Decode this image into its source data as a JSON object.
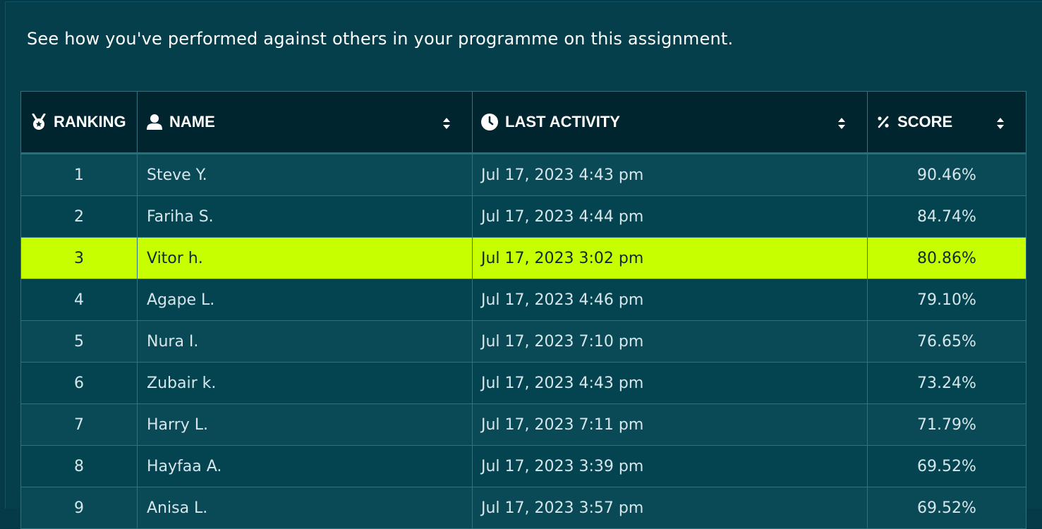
{
  "intro_text": "See how you've performed against others in your programme on this assignment.",
  "columns": {
    "ranking": "RANKING",
    "name": "NAME",
    "last_activity": "LAST ACTIVITY",
    "score": "SCORE"
  },
  "icons": {
    "ranking": "medal-icon",
    "name": "user-icon",
    "last_activity": "clock-icon",
    "score": "percent-icon",
    "sort": "sort-icon"
  },
  "colors": {
    "background": "#043f4b",
    "header": "#01252f",
    "highlight": "#c8ff00"
  },
  "rows": [
    {
      "rank": "1",
      "name": "Steve Y.",
      "last_activity": "Jul 17, 2023 4:43 pm",
      "score": "90.46%",
      "highlight": false
    },
    {
      "rank": "2",
      "name": "Fariha S.",
      "last_activity": "Jul 17, 2023 4:44 pm",
      "score": "84.74%",
      "highlight": false
    },
    {
      "rank": "3",
      "name": "Vitor h.",
      "last_activity": "Jul 17, 2023 3:02 pm",
      "score": "80.86%",
      "highlight": true
    },
    {
      "rank": "4",
      "name": "Agape L.",
      "last_activity": "Jul 17, 2023 4:46 pm",
      "score": "79.10%",
      "highlight": false
    },
    {
      "rank": "5",
      "name": "Nura I.",
      "last_activity": "Jul 17, 2023 7:10 pm",
      "score": "76.65%",
      "highlight": false
    },
    {
      "rank": "6",
      "name": "Zubair k.",
      "last_activity": "Jul 17, 2023 4:43 pm",
      "score": "73.24%",
      "highlight": false
    },
    {
      "rank": "7",
      "name": "Harry L.",
      "last_activity": "Jul 17, 2023 7:11 pm",
      "score": "71.79%",
      "highlight": false
    },
    {
      "rank": "8",
      "name": "Hayfaa A.",
      "last_activity": "Jul 17, 2023 3:39 pm",
      "score": "69.52%",
      "highlight": false
    },
    {
      "rank": "9",
      "name": "Anisa L.",
      "last_activity": "Jul 17, 2023 3:57 pm",
      "score": "69.52%",
      "highlight": false
    }
  ]
}
